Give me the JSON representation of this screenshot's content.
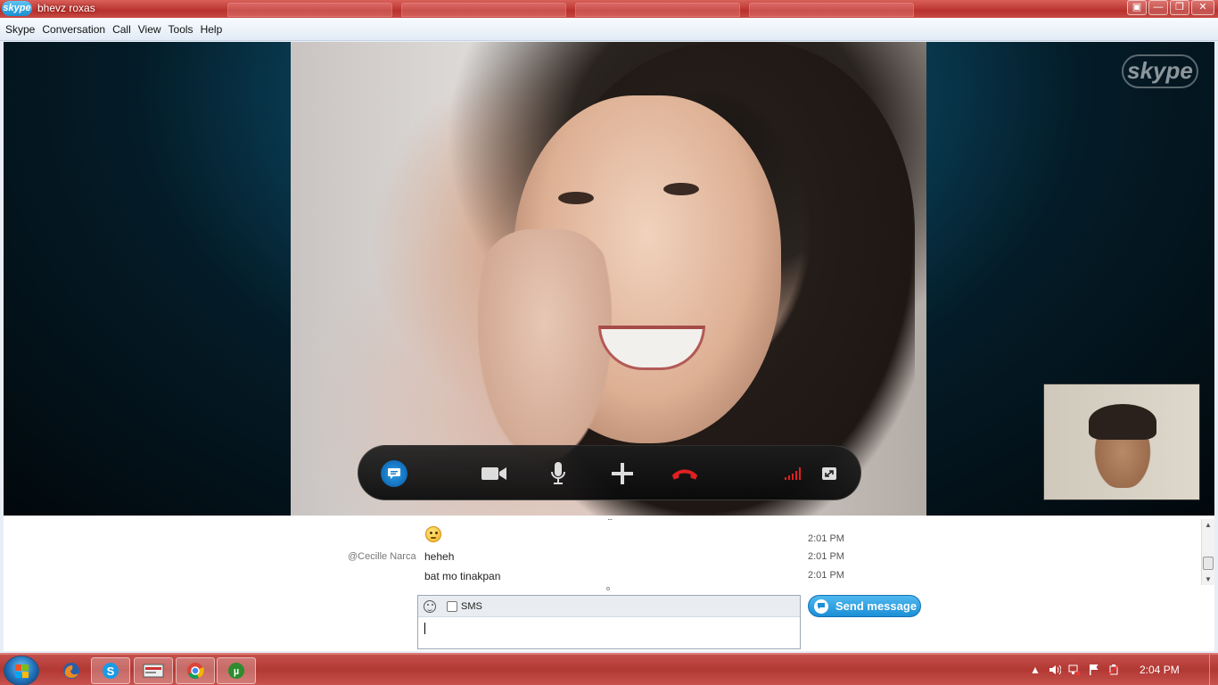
{
  "window": {
    "title": "bhevz roxas",
    "app_logo_text": "skype",
    "controls": {
      "restore_extra": "▣",
      "minimize": "—",
      "maximize": "❐",
      "close": "✕"
    }
  },
  "menu": [
    "Skype",
    "Conversation",
    "Call",
    "View",
    "Tools",
    "Help"
  ],
  "video": {
    "watermark": "skype",
    "call_controls": {
      "chat": "chat-icon",
      "video": "video-camera-icon",
      "mic": "microphone-icon",
      "add": "plus-icon",
      "hangup": "hang-up-icon",
      "signal": "signal-strength-icon",
      "fullscreen": "fullscreen-icon"
    }
  },
  "chat": {
    "messages": [
      {
        "sender": "",
        "content": "",
        "emoji": "smiley-emoji",
        "time": "2:01 PM"
      },
      {
        "sender": "@Cecille Narca",
        "content": "heheh",
        "time": "2:01 PM"
      },
      {
        "sender": "",
        "content": "bat mo tinakpan",
        "time": "2:01 PM"
      }
    ],
    "divider": "...",
    "sms_label": "SMS",
    "input_value": "",
    "send_label": "Send message"
  },
  "taskbar": {
    "apps": [
      "firefox-icon",
      "skype-icon",
      "app-icon",
      "chrome-icon",
      "utorrent-icon"
    ],
    "clock": "2:04 PM"
  },
  "colors": {
    "accent": "#1b8fd6",
    "titlebar": "#b8322d",
    "hangup": "#e02020",
    "signal": "#e02020"
  }
}
